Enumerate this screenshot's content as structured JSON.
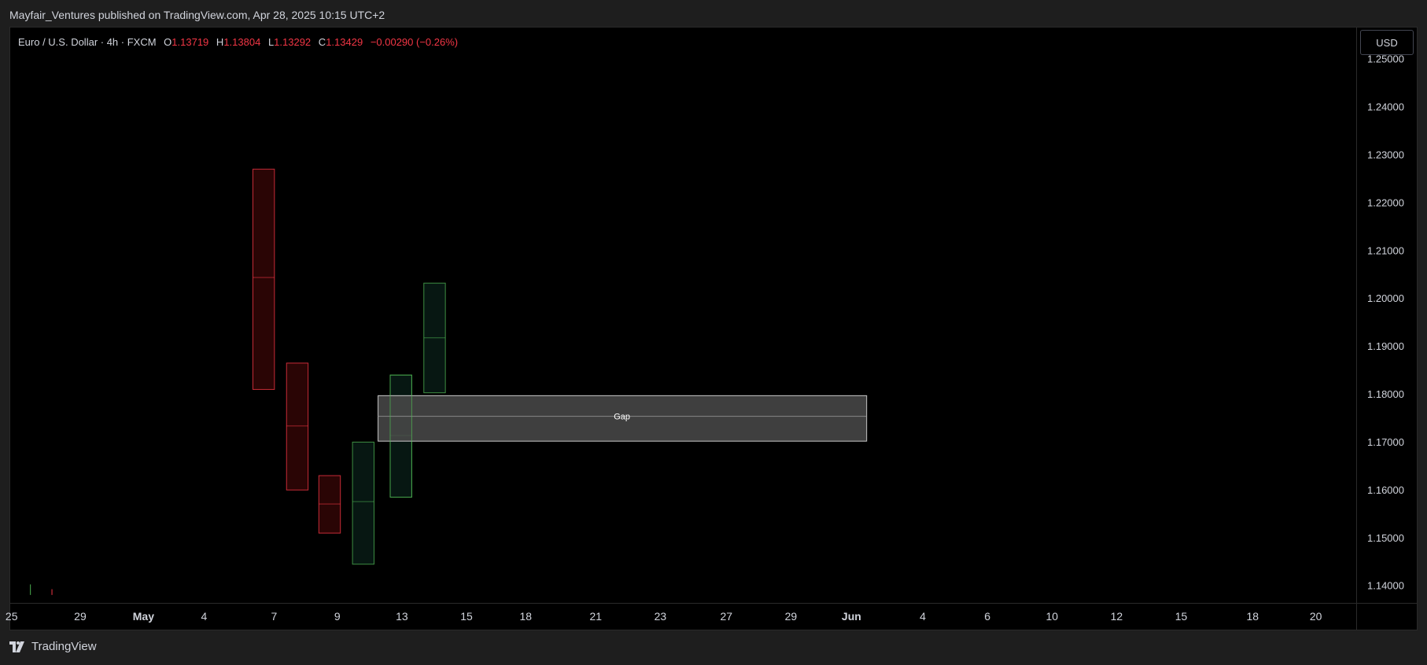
{
  "header": {
    "publish_text": "Mayfair_Ventures published on TradingView.com, Apr 28, 2025 10:15 UTC+2"
  },
  "legend": {
    "symbol": "Euro / U.S. Dollar · 4h · FXCM",
    "o_label": "O",
    "o_value": "1.13719",
    "h_label": "H",
    "h_value": "1.13804",
    "l_label": "L",
    "l_value": "1.13292",
    "c_label": "C",
    "c_value": "1.13429",
    "change": "−0.00290 (−0.26%)"
  },
  "currency_button": "USD",
  "footer": {
    "brand": "TradingView",
    "logo_icon": "tradingview-logo-icon"
  },
  "colors": {
    "bear": "#f23645",
    "bear_fill": "#2a0505",
    "bull": "#4caf50",
    "bull_fill": "#071712",
    "gap_fill": "#4a4a4a",
    "gap_border": "#c8c8c8"
  },
  "chart_data": {
    "type": "candlestick",
    "y_range": [
      1.1365,
      1.2565
    ],
    "y_ticks": [
      "1.25000",
      "1.24000",
      "1.23000",
      "1.22000",
      "1.21000",
      "1.20000",
      "1.19000",
      "1.18000",
      "1.17000",
      "1.16000",
      "1.15000",
      "1.14000"
    ],
    "x_range": [
      0,
      100
    ],
    "x_ticks": [
      {
        "label": "25",
        "x": 0.1
      },
      {
        "label": "29",
        "x": 5.2
      },
      {
        "label": "May",
        "x": 9.9,
        "bold": true
      },
      {
        "label": "4",
        "x": 14.4
      },
      {
        "label": "7",
        "x": 19.6
      },
      {
        "label": "9",
        "x": 24.3
      },
      {
        "label": "13",
        "x": 29.1
      },
      {
        "label": "15",
        "x": 33.9
      },
      {
        "label": "18",
        "x": 38.3
      },
      {
        "label": "21",
        "x": 43.5
      },
      {
        "label": "23",
        "x": 48.3
      },
      {
        "label": "27",
        "x": 53.2
      },
      {
        "label": "29",
        "x": 58.0
      },
      {
        "label": "Jun",
        "x": 62.5,
        "bold": true
      },
      {
        "label": "4",
        "x": 67.8
      },
      {
        "label": "6",
        "x": 72.6
      },
      {
        "label": "10",
        "x": 77.4
      },
      {
        "label": "12",
        "x": 82.2
      },
      {
        "label": "15",
        "x": 87.0
      },
      {
        "label": "18",
        "x": 92.3
      },
      {
        "label": "20",
        "x": 97.0
      }
    ],
    "boxes": [
      {
        "x": 18.0,
        "w": 1.6,
        "top": 1.227,
        "bottom": 1.181,
        "mid": 1.2043,
        "dir": "bear"
      },
      {
        "x": 20.5,
        "w": 1.6,
        "top": 1.1865,
        "bottom": 1.16,
        "mid": 1.1733,
        "dir": "bear"
      },
      {
        "x": 22.9,
        "w": 1.6,
        "top": 1.163,
        "bottom": 1.151,
        "mid": 1.157,
        "dir": "bear"
      },
      {
        "x": 25.4,
        "w": 1.6,
        "top": 1.17,
        "bottom": 1.1445,
        "mid": 1.1575,
        "dir": "bull"
      },
      {
        "x": 28.2,
        "w": 1.6,
        "top": 1.184,
        "bottom": 1.1585,
        "mid": 1.1713,
        "dir": "bull"
      },
      {
        "x": 30.7,
        "w": 1.6,
        "top": 1.2032,
        "bottom": 1.1803,
        "mid": 1.1917,
        "dir": "bull"
      }
    ],
    "gap": {
      "label": "Gap",
      "x1": 27.3,
      "x2": 63.6,
      "top": 1.1797,
      "bottom": 1.1702,
      "mid": 1.1753
    },
    "ticks_small": [
      {
        "x": 1.5,
        "top": 1.1402,
        "bottom": 1.138,
        "dir": "bull"
      },
      {
        "x": 3.1,
        "top": 1.1392,
        "bottom": 1.138,
        "dir": "bear"
      }
    ]
  }
}
